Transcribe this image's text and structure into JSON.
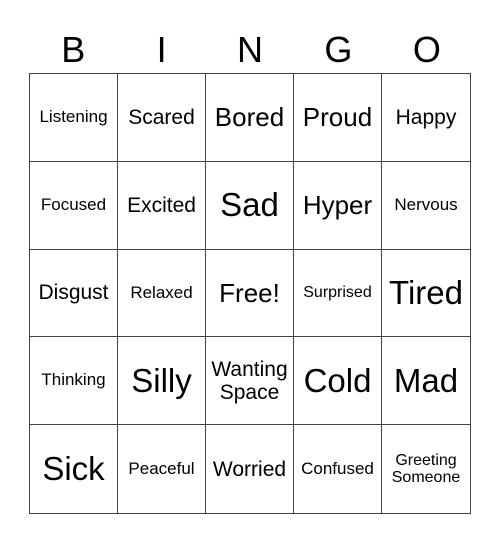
{
  "header": [
    "B",
    "I",
    "N",
    "G",
    "O"
  ],
  "cells": [
    {
      "text": "Listening",
      "size": "s1"
    },
    {
      "text": "Scared",
      "size": "s2"
    },
    {
      "text": "Bored",
      "size": "s3"
    },
    {
      "text": "Proud",
      "size": "s3"
    },
    {
      "text": "Happy",
      "size": "s2"
    },
    {
      "text": "Focused",
      "size": "s1"
    },
    {
      "text": "Excited",
      "size": "s2"
    },
    {
      "text": "Sad",
      "size": "s4"
    },
    {
      "text": "Hyper",
      "size": "s3"
    },
    {
      "text": "Nervous",
      "size": "s1"
    },
    {
      "text": "Disgust",
      "size": "s2"
    },
    {
      "text": "Relaxed",
      "size": "s1"
    },
    {
      "text": "Free!",
      "size": "s3"
    },
    {
      "text": "Surprised",
      "size": "s0"
    },
    {
      "text": "Tired",
      "size": "s4"
    },
    {
      "text": "Thinking",
      "size": "s1"
    },
    {
      "text": "Silly",
      "size": "s4"
    },
    {
      "text": "Wanting Space",
      "size": "s2"
    },
    {
      "text": "Cold",
      "size": "s4"
    },
    {
      "text": "Mad",
      "size": "s4"
    },
    {
      "text": "Sick",
      "size": "s4"
    },
    {
      "text": "Peaceful",
      "size": "s1"
    },
    {
      "text": "Worried",
      "size": "s2"
    },
    {
      "text": "Confused",
      "size": "s1"
    },
    {
      "text": "Greeting Someone",
      "size": "s0"
    }
  ]
}
